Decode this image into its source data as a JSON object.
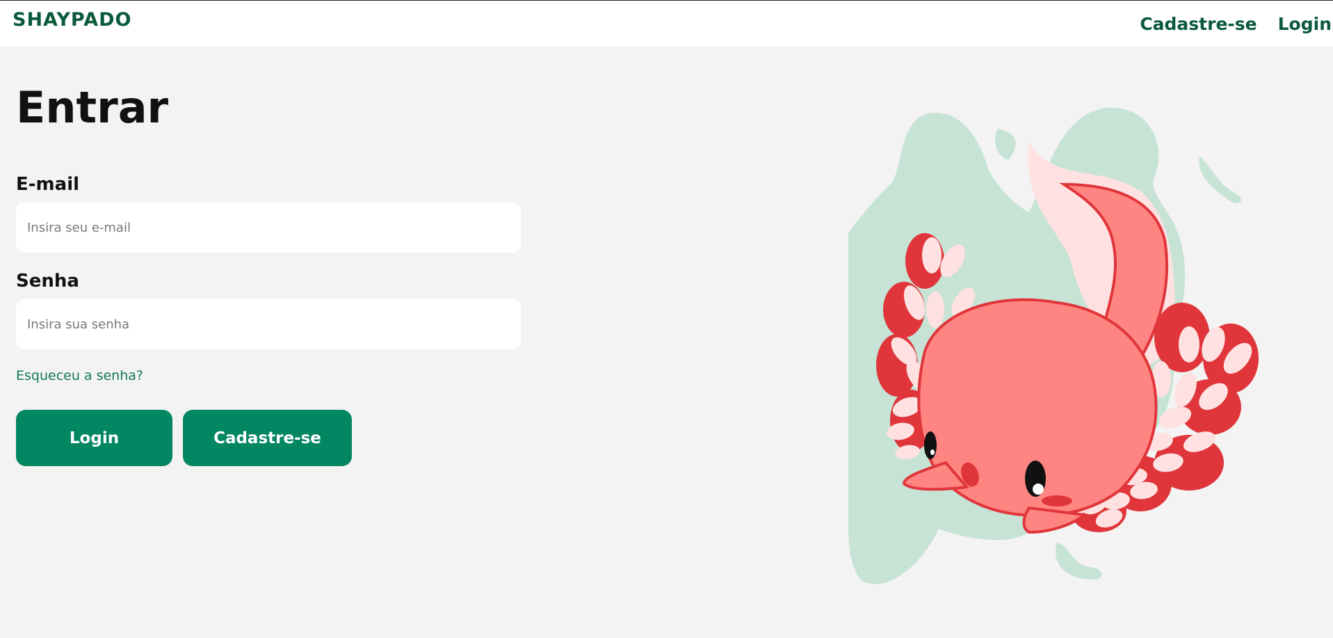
{
  "brand": {
    "logo": "SHAYPADO"
  },
  "nav": {
    "signup": "Cadastre-se",
    "login": "Login"
  },
  "form": {
    "title": "Entrar",
    "email_label": "E-mail",
    "email_placeholder": "Insira seu e-mail",
    "email_value": "",
    "password_label": "Senha",
    "password_placeholder": "Insira sua senha",
    "password_value": "",
    "forgot": "Esqueceu a senha?",
    "login_button": "Login",
    "signup_button": "Cadastre-se"
  },
  "colors": {
    "accent": "#038762",
    "brand_dark": "#0b5a3c",
    "background": "#f3f3f3",
    "blob": "#c6e3d6",
    "axolotl_body": "#ff8583",
    "axolotl_outline": "#e0353a"
  },
  "illustration": {
    "icon": "axolotl-illustration"
  }
}
